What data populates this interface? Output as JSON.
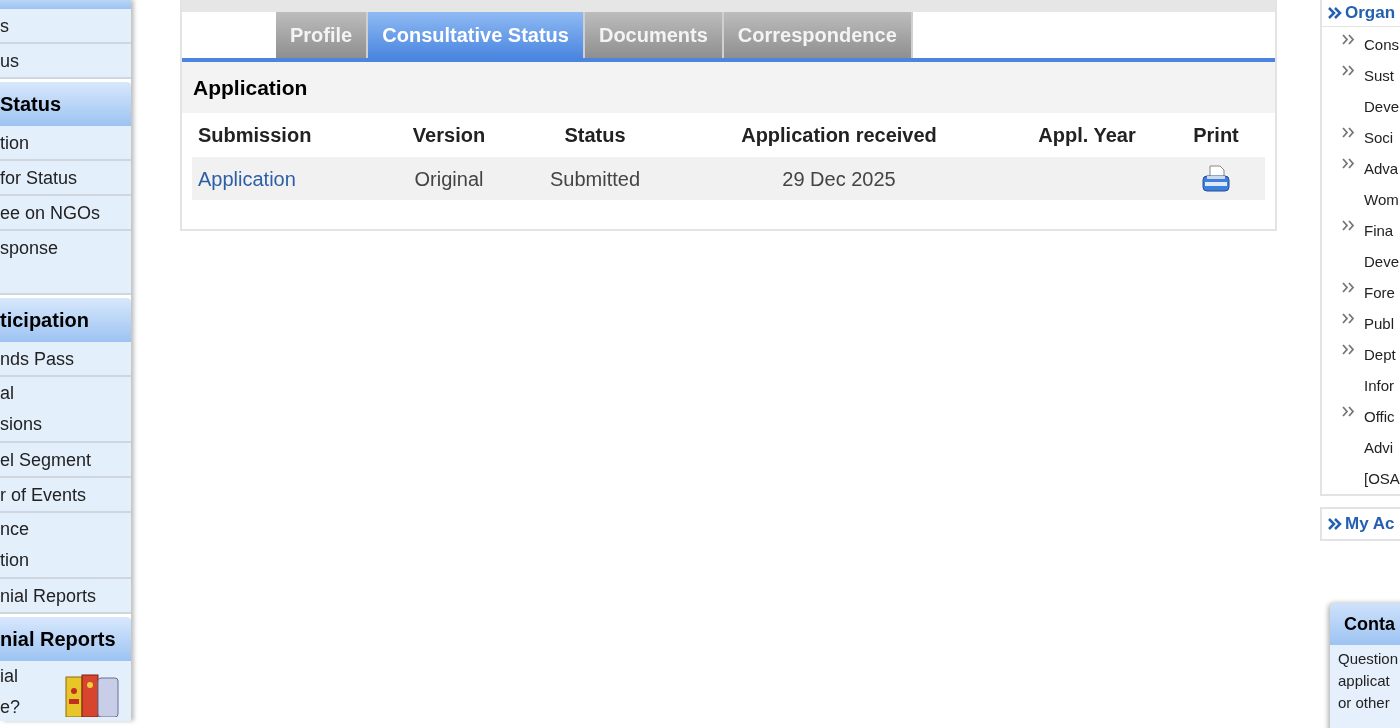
{
  "left_nav": [
    {
      "kind": "band"
    },
    {
      "kind": "item",
      "lines": [
        "s"
      ]
    },
    {
      "kind": "item",
      "lines": [
        "us"
      ]
    },
    {
      "kind": "header",
      "lines": [
        "Status"
      ]
    },
    {
      "kind": "item",
      "lines": [
        "tion"
      ]
    },
    {
      "kind": "item",
      "lines": [
        "for Status"
      ]
    },
    {
      "kind": "item",
      "lines": [
        "ee on NGOs"
      ]
    },
    {
      "kind": "tall",
      "lines": [
        "sponse"
      ]
    },
    {
      "kind": "header",
      "lines": [
        "ticipation"
      ]
    },
    {
      "kind": "item",
      "lines": [
        "nds Pass"
      ]
    },
    {
      "kind": "item",
      "lines": [
        "al",
        "sions"
      ]
    },
    {
      "kind": "item",
      "lines": [
        "el Segment"
      ]
    },
    {
      "kind": "item",
      "lines": [
        "r of Events"
      ]
    },
    {
      "kind": "item",
      "lines": [
        "nce",
        "tion"
      ]
    },
    {
      "kind": "item",
      "lines": [
        "nial Reports"
      ]
    },
    {
      "kind": "header",
      "lines": [
        "nial Reports"
      ]
    },
    {
      "kind": "promo",
      "lines": [
        "ial",
        "e?"
      ]
    }
  ],
  "tabs": [
    {
      "label": "Profile",
      "selected": false
    },
    {
      "label": "Consultative Status",
      "selected": true
    },
    {
      "label": "Documents",
      "selected": false
    },
    {
      "label": "Correspondence",
      "selected": false
    }
  ],
  "section": {
    "title": "Application"
  },
  "table": {
    "columns": [
      "Submission",
      "Version",
      "Status",
      "Application received",
      "Appl. Year",
      "Print"
    ],
    "rows": [
      {
        "submission": "Application",
        "version": "Original",
        "status": "Submitted",
        "received": "29 Dec 2025",
        "print": true
      }
    ]
  },
  "right_nav": {
    "title": "Organ",
    "items": [
      {
        "lines": [
          "Cons"
        ]
      },
      {
        "lines": [
          "Sust",
          "Deve"
        ]
      },
      {
        "lines": [
          "Soci"
        ]
      },
      {
        "lines": [
          "Adva",
          "Wom"
        ]
      },
      {
        "lines": [
          "Fina",
          "Deve"
        ]
      },
      {
        "lines": [
          "Fore"
        ]
      },
      {
        "lines": [
          "Publ"
        ]
      },
      {
        "lines": [
          "Dept",
          "Infor"
        ]
      },
      {
        "lines": [
          "Offic",
          "Advi",
          "[OSA"
        ]
      }
    ]
  },
  "account_box": {
    "title": "My Ac"
  },
  "contact": {
    "title": "Conta",
    "lines": [
      "Question",
      "applicat",
      "or other"
    ]
  }
}
